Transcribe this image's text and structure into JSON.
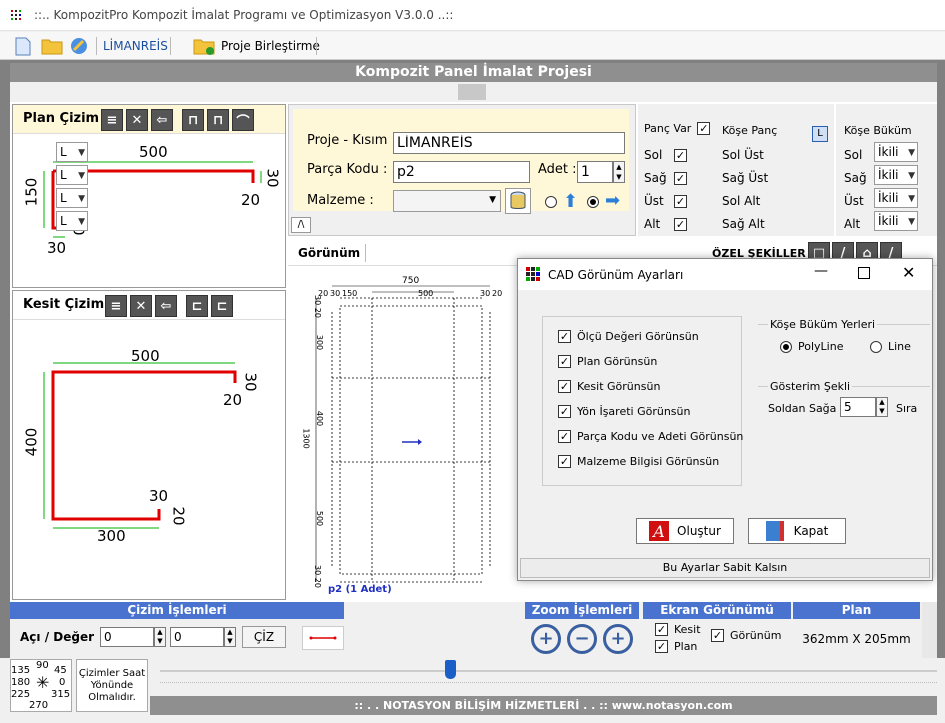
{
  "window": {
    "title": "::.. KompozitPro Kompozit İmalat Programı ve Optimizasyon V3.0.0 ..::"
  },
  "toolbar": {
    "project_label": "LİMANREİS",
    "merge_label": "Proje Birleştirme"
  },
  "main": {
    "title": "Kompozit Panel İmalat Projesi"
  },
  "plan_panel": {
    "title": "Plan Çizim",
    "dims": {
      "top": "500",
      "left": "150",
      "right": "30",
      "right_sub": "20",
      "bottom": "30",
      "bottom_sub": "20"
    }
  },
  "kesit_panel": {
    "title": "Kesit Çizim",
    "dims": {
      "top": "500",
      "left": "400",
      "right": "30",
      "right_sub": "20",
      "bottom": "300",
      "bottom_a": "30",
      "bottom_b": "20"
    }
  },
  "form": {
    "project_label": "Proje - Kısım :",
    "project_value": "LİMANREİS",
    "part_label": "Parça Kodu :",
    "part_value": "p2",
    "qty_label": "Adet :",
    "qty_value": "1",
    "material_label": "Malzeme :",
    "collapse": "/\\"
  },
  "panc": {
    "title": "Panç Var",
    "items": [
      "Sol",
      "Sağ",
      "Üst",
      "Alt"
    ]
  },
  "kose_panc": {
    "title": "Köşe Panç",
    "badge": "L",
    "items": [
      "Sol Üst",
      "Sağ Üst",
      "Sol Alt",
      "Sağ Alt"
    ],
    "value": "L"
  },
  "kose_bukum": {
    "title": "Köşe Büküm",
    "items": [
      "Sol",
      "Sağ",
      "Üst",
      "Alt"
    ],
    "value": "İkili"
  },
  "gorunum": {
    "title": "Görünüm",
    "special": "ÖZEL ŞEKİLLER :"
  },
  "drawing": {
    "width": "750",
    "inner_width": "500",
    "left_a": "20",
    "left_b": "30",
    "left_c": "150",
    "right_a": "30",
    "right_b": "20",
    "height": "1300",
    "h1": "300",
    "h2": "400",
    "h3": "500",
    "edge_top": "30 20",
    "edge_bottom": "30 20",
    "caption": "p2 (1 Adet)"
  },
  "dialog": {
    "title": "CAD Görünüm Ayarları",
    "options": [
      "Ölçü Değeri Görünsün",
      "Plan Görünsün",
      "Kesit Görünsün",
      "Yön İşareti Görünsün",
      "Parça Kodu ve Adeti Görünsün",
      "Malzeme Bilgisi Görünsün"
    ],
    "bend_group": "Köşe Büküm Yerleri",
    "bend_opt1": "PolyLine",
    "bend_opt2": "Line",
    "display_group": "Gösterim Şekli",
    "display_label": "Soldan Sağa",
    "display_value": "5",
    "display_unit": "Sıra",
    "create": "Oluştur",
    "close": "Kapat",
    "fixed": "Bu Ayarlar Sabit Kalsın"
  },
  "bottom": {
    "cizim_title": "Çizim İşlemleri",
    "angle_label": "Açı / Değer",
    "angle_a": "0",
    "angle_b": "0",
    "draw_button": "ÇİZ",
    "zoom_title": "Zoom İşlemleri",
    "ekran_title": "Ekran Görünümü",
    "ekran_kesit": "Kesit",
    "ekran_plan": "Plan",
    "ekran_gorunum": "Görünüm",
    "plan_title": "Plan",
    "plan_size": "362mm X 205mm"
  },
  "status": {
    "angles": {
      "a90": "90",
      "a45": "45",
      "a135": "135",
      "a0": "0",
      "a180": "180",
      "a225": "225",
      "a315": "315",
      "a270": "270"
    },
    "note": "Çizimler Saat Yönünde Olmalıdır.",
    "footer": ":: . . NOTASYON BİLİŞİM HİZMETLERİ . . ::    www.notasyon.com"
  },
  "colors": {
    "accent_blue": "#4a73d0",
    "frame_gray": "#8f8f8f",
    "draw_red": "#e00000",
    "dim_green": "#00b000"
  }
}
